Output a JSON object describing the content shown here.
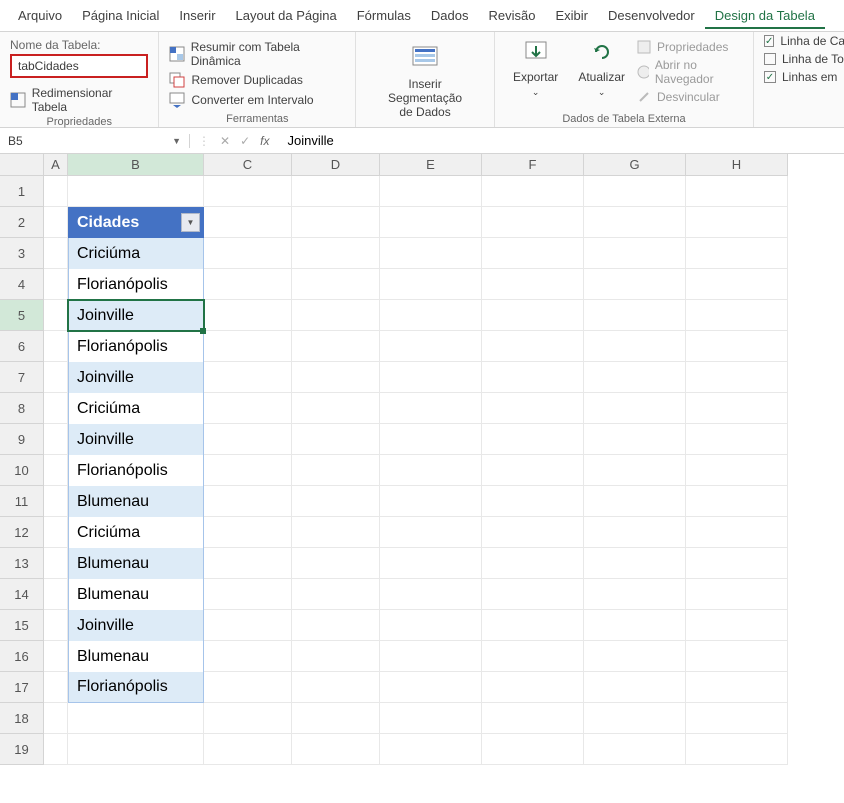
{
  "menu": {
    "items": [
      "Arquivo",
      "Página Inicial",
      "Inserir",
      "Layout da Página",
      "Fórmulas",
      "Dados",
      "Revisão",
      "Exibir",
      "Desenvolvedor",
      "Design da Tabela"
    ],
    "active_index": 9
  },
  "ribbon": {
    "properties": {
      "label": "Nome da Tabela:",
      "table_name": "tabCidades",
      "resize": "Redimensionar Tabela",
      "group_label": "Propriedades"
    },
    "tools": {
      "pivot": "Resumir com Tabela Dinâmica",
      "dedupe": "Remover Duplicadas",
      "convert": "Converter em Intervalo",
      "group_label": "Ferramentas"
    },
    "slicer": {
      "line1": "Inserir Segmentação",
      "line2": "de Dados"
    },
    "export": "Exportar",
    "refresh": "Atualizar",
    "external": {
      "props": "Propriedades",
      "browser": "Abrir no Navegador",
      "unlink": "Desvincular",
      "group_label": "Dados de Tabela Externa"
    },
    "options": {
      "header_row": "Linha de Ca",
      "total_row": "Linha de To",
      "banded_rows": "Linhas em"
    }
  },
  "formula_bar": {
    "cell_ref": "B5",
    "formula": "Joinville"
  },
  "grid": {
    "columns": [
      {
        "label": "A",
        "width": 24
      },
      {
        "label": "B",
        "width": 136
      },
      {
        "label": "C",
        "width": 88
      },
      {
        "label": "D",
        "width": 88
      },
      {
        "label": "E",
        "width": 102
      },
      {
        "label": "F",
        "width": 102
      },
      {
        "label": "G",
        "width": 102
      },
      {
        "label": "H",
        "width": 102
      }
    ],
    "active_col_index": 1,
    "rows": 19,
    "active_row": 5
  },
  "table": {
    "header": "Cidades",
    "data": [
      "Criciúma",
      "Florianópolis",
      "Joinville",
      "Florianópolis",
      "Joinville",
      "Criciúma",
      "Joinville",
      "Florianópolis",
      "Blumenau",
      "Criciúma",
      "Blumenau",
      "Blumenau",
      "Joinville",
      "Blumenau",
      "Florianópolis"
    ],
    "selected_index": 2
  }
}
